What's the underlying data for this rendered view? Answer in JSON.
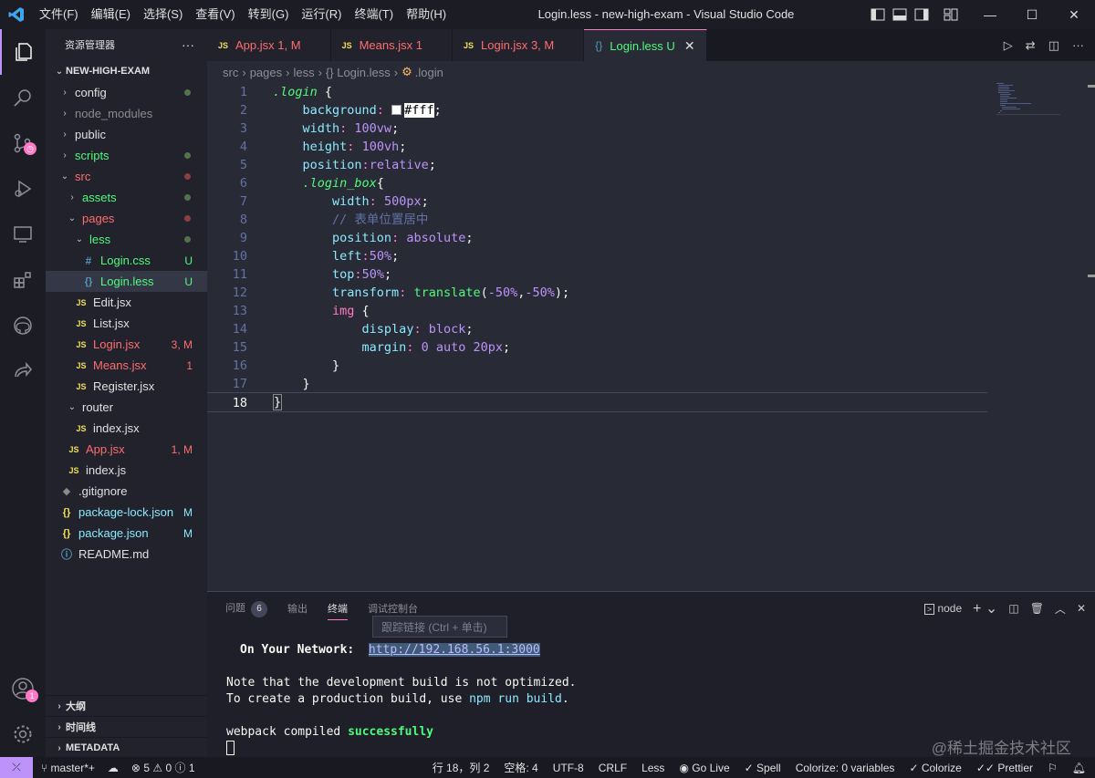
{
  "titlebar": {
    "menu": [
      "文件(F)",
      "编辑(E)",
      "选择(S)",
      "查看(V)",
      "转到(G)",
      "运行(R)",
      "终端(T)",
      "帮助(H)"
    ],
    "title": "Login.less - new-high-exam - Visual Studio Code"
  },
  "sidebar": {
    "header": "资源管理器",
    "root": "NEW-HIGH-EXAM",
    "items": [
      {
        "label": "config",
        "chev": "›",
        "color": "c-default"
      },
      {
        "label": "node_modules",
        "chev": "›",
        "color": "c-gray"
      },
      {
        "label": "public",
        "chev": "›",
        "color": "c-default"
      },
      {
        "label": "scripts",
        "chev": "›",
        "color": "c-green"
      },
      {
        "label": "src",
        "chev": "⌄",
        "color": "c-red"
      },
      {
        "label": "assets",
        "chev": "›",
        "color": "c-green"
      },
      {
        "label": "pages",
        "chev": "⌄",
        "color": "c-red"
      },
      {
        "label": "less",
        "chev": "⌄",
        "color": "c-green"
      },
      {
        "label": "Login.css",
        "badge": "U",
        "color": "c-green"
      },
      {
        "label": "Login.less",
        "badge": "U",
        "color": "c-green"
      },
      {
        "label": "Edit.jsx",
        "color": "c-default"
      },
      {
        "label": "List.jsx",
        "color": "c-default"
      },
      {
        "label": "Login.jsx",
        "badge": "3, M",
        "color": "c-red"
      },
      {
        "label": "Means.jsx",
        "badge": "1",
        "color": "c-red"
      },
      {
        "label": "Register.jsx",
        "color": "c-default"
      },
      {
        "label": "router",
        "chev": "⌄",
        "color": "c-default"
      },
      {
        "label": "index.jsx",
        "color": "c-default"
      },
      {
        "label": "App.jsx",
        "badge": "1, M",
        "color": "c-red"
      },
      {
        "label": "index.js",
        "color": "c-default"
      },
      {
        "label": ".gitignore",
        "color": "c-default"
      },
      {
        "label": "package-lock.json",
        "badge": "M",
        "color": "c-m"
      },
      {
        "label": "package.json",
        "badge": "M",
        "color": "c-m"
      },
      {
        "label": "README.md",
        "color": "c-default"
      }
    ],
    "sections": [
      "大纲",
      "时间线",
      "METADATA"
    ]
  },
  "tabs": [
    {
      "icon": "JS",
      "name": "App.jsx",
      "status": "1, M"
    },
    {
      "icon": "JS",
      "name": "Means.jsx",
      "status": "1"
    },
    {
      "icon": "JS",
      "name": "Login.jsx",
      "status": "3, M"
    },
    {
      "icon": "{}",
      "name": "Login.less",
      "status": "U"
    }
  ],
  "breadcrumb": [
    "src",
    "pages",
    "less",
    "{} Login.less",
    ".login"
  ],
  "editor": {
    "line_numbers": [
      "1",
      "2",
      "3",
      "4",
      "5",
      "6",
      "7",
      "8",
      "9",
      "10",
      "11",
      "12",
      "13",
      "14",
      "15",
      "16",
      "17",
      "18"
    ],
    "current_line": "18",
    "code_selector": ".login",
    "comment": "// 表单位置居中",
    "color_value": "#fff"
  },
  "panel": {
    "tabs": [
      "问题",
      "输出",
      "终端",
      "调试控制台"
    ],
    "problems_count": "6",
    "terminal_kind": "node",
    "tooltip": "跟踪链接 (Ctrl + 单击)",
    "network_label": "On Your Network:",
    "network_url": "http://192.168.56.1:3000",
    "lines": [
      "Note that the development build is not optimized.",
      "To create a production build, use npm run build.",
      "webpack compiled successfully"
    ]
  },
  "statusbar": {
    "branch": "master*+",
    "errors": "5",
    "warnings": "0",
    "infos": "1",
    "position": "行 18，列 2",
    "spaces": "空格: 4",
    "encoding": "UTF-8",
    "eol": "CRLF",
    "language": "Less",
    "golive": "Go Live",
    "spell": "Spell",
    "colorize_vars": "Colorize: 0 variables",
    "colorize": "Colorize",
    "prettier": "Prettier"
  },
  "watermark": "@稀土掘金技术社区",
  "accounts_badge": "1"
}
